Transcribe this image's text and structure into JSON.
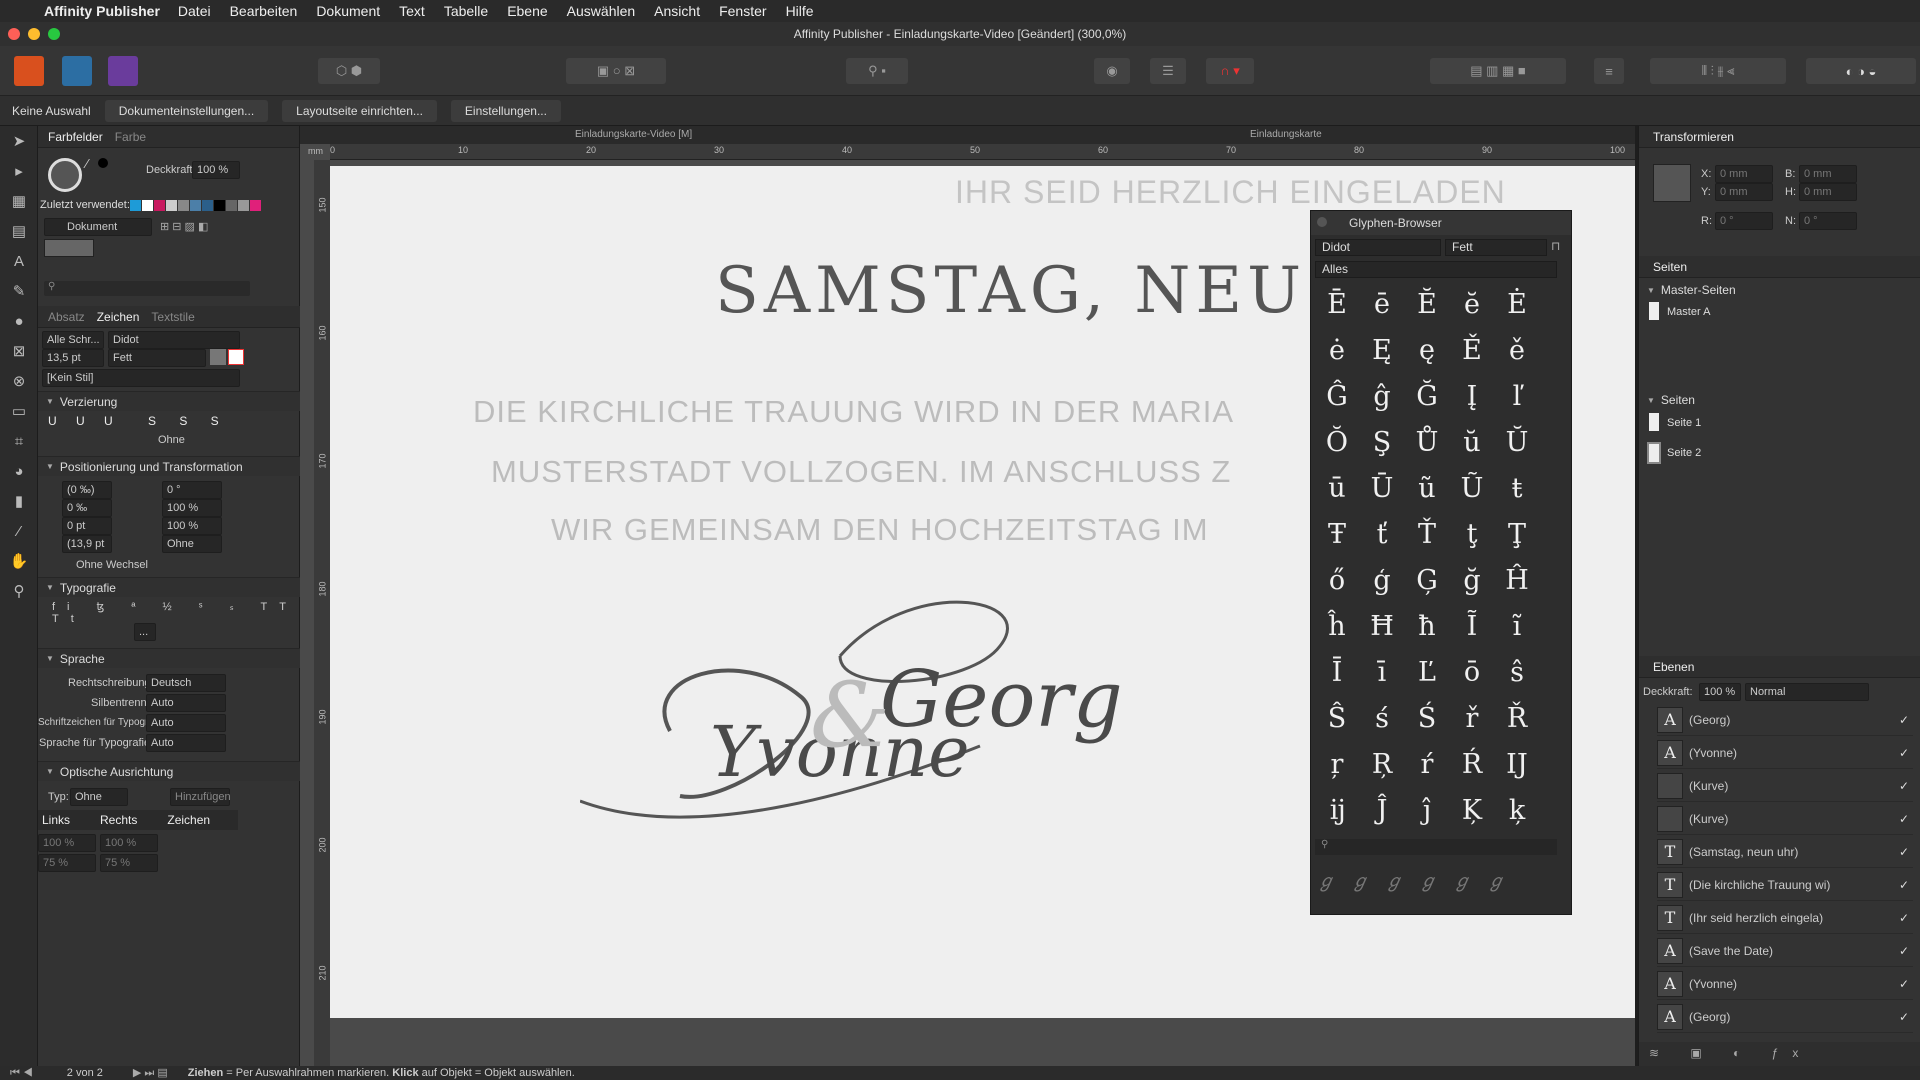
{
  "menubar": {
    "app": "Affinity Publisher",
    "items": [
      "Datei",
      "Bearbeiten",
      "Dokument",
      "Text",
      "Tabelle",
      "Ebene",
      "Auswählen",
      "Ansicht",
      "Fenster",
      "Hilfe"
    ]
  },
  "window_title": "Affinity Publisher - Einladungskarte-Video [Geändert] (300,0%)",
  "context": {
    "selection": "Keine Auswahl",
    "btn1": "Dokumenteinstellungen...",
    "btn2": "Layoutseite einrichten...",
    "btn3": "Einstellungen..."
  },
  "swatches": {
    "tab1": "Farbfelder",
    "tab2": "Farbe",
    "opacity_label": "Deckkraft:",
    "opacity": "100 %",
    "recent_label": "Zuletzt verwendet:",
    "palette": "Dokument",
    "recent_colors": [
      "#1e9bd7",
      "#ffffff",
      "#c8195f",
      "#cccccc",
      "#888888",
      "#4c7fa8",
      "#2b5f8a",
      "#000000",
      "#666666",
      "#999999",
      "#e0207a"
    ]
  },
  "character": {
    "tab1": "Absatz",
    "tab2": "Zeichen",
    "tab3": "Textstile",
    "font_collection": "Alle Schr...",
    "font": "Didot",
    "size": "13,5 pt",
    "weight": "Fett",
    "style": "[Kein Stil]",
    "sec_deco": "Verzierung",
    "deco_none": "Ohne",
    "sec_pos": "Positionierung und Transformation",
    "kerning": "(0 ‰)",
    "tracking": "0 ‰",
    "baseline": "0 pt",
    "leading": "(13,9 pt",
    "shear": "0 °",
    "vscale": "100 %",
    "hscale": "100 %",
    "pos": "Ohne",
    "nobreak": "Ohne Wechsel",
    "sec_typo": "Typografie",
    "more": "...",
    "sec_lang": "Sprache",
    "spell_l": "Rechtschreibung:",
    "spell": "Deutsch",
    "hyph_l": "Silbentrennung:",
    "hyph": "Auto",
    "glyph_l": "Schriftzeichen für Typografie:",
    "glyph": "Auto",
    "lang_l": "Sprache für Typografie:",
    "lang": "Auto",
    "sec_opt": "Optische Ausrichtung",
    "type_l": "Typ:",
    "type": "Ohne",
    "add": "Hinzufügen",
    "col1": "Links",
    "col2": "Rechts",
    "col3": "Zeichen",
    "r1a": "100 %",
    "r1b": "100 %",
    "r2a": "75 %",
    "r2b": "75 %"
  },
  "doc": {
    "tab1": "Einladungskarte-Video [M]",
    "tab2": "Einladungskarte",
    "ruler_unit": "mm",
    "hticks": [
      "0",
      "10",
      "20",
      "30",
      "40",
      "50",
      "60",
      "70",
      "80",
      "90",
      "100"
    ],
    "vticks": [
      "150",
      "160",
      "170",
      "180",
      "190",
      "200",
      "210"
    ]
  },
  "page_text": {
    "line1": "IHR SEID HERZLICH EINGELADEN",
    "line2": "SAMSTAG, NEU",
    "line3": "DIE KIRCHLICHE TRAUUNG WIRD IN DER MARIA",
    "line4": "MUSTERSTADT VOLLZOGEN. IM ANSCHLUSS Z",
    "line5": "WIR  GEMEINSAM DEN HOCHZEITSTAG IM",
    "script1": "Georg",
    "script2": "Yvonne",
    "amp": "&"
  },
  "glyph_browser": {
    "title": "Glyphen-Browser",
    "font": "Didot",
    "weight": "Fett",
    "range": "Alles",
    "glyphs": [
      "Ē",
      "ē",
      "Ĕ",
      "ĕ",
      "Ė",
      "ė",
      "Ę",
      "ę",
      "Ě",
      "ě",
      "Ĝ",
      "ĝ",
      "Ğ",
      "Į",
      "ľ",
      "Ŏ",
      "Ş",
      "Ů",
      "ŭ",
      "Ŭ",
      "ū",
      "Ū",
      "ũ",
      "Ũ",
      "ŧ",
      "Ŧ",
      "ť",
      "Ť",
      "ţ",
      "Ţ",
      "ő",
      "ģ",
      "Ģ",
      "ğ",
      "Ĥ",
      "ĥ",
      "Ħ",
      "ħ",
      "Ĩ",
      "ĩ",
      "Ī",
      "ī",
      "Ľ",
      "ō",
      "ŝ",
      "Ŝ",
      "ś",
      "Ś",
      "ř",
      "Ř",
      "ŗ",
      "Ŗ",
      "ŕ",
      "Ŕ",
      "Ĳ",
      "ĳ",
      "Ĵ",
      "ĵ",
      "Ķ",
      "ķ"
    ]
  },
  "transform": {
    "title": "Transformieren",
    "x_l": "X:",
    "x": "0 mm",
    "y_l": "Y:",
    "y": "0 mm",
    "b_l": "B:",
    "b": "0 mm",
    "h_l": "H:",
    "h": "0 mm",
    "r_l": "R:",
    "r": "0 °",
    "n_l": "N:",
    "n": "0 °"
  },
  "pages": {
    "title": "Seiten",
    "master_sec": "Master-Seiten",
    "master": "Master A",
    "pages_sec": "Seiten",
    "p1": "Seite 1",
    "p2": "Seite 2"
  },
  "layers": {
    "title": "Ebenen",
    "opacity_l": "Deckkraft:",
    "opacity": "100 %",
    "blend": "Normal",
    "items": [
      {
        "icon": "A",
        "name": "(Georg)"
      },
      {
        "icon": "A",
        "name": "(Yvonne)"
      },
      {
        "icon": "",
        "name": "(Kurve)"
      },
      {
        "icon": "",
        "name": "(Kurve)"
      },
      {
        "icon": "T",
        "name": "(Samstag, neun uhr)"
      },
      {
        "icon": "T",
        "name": "(Die kirchliche Trauung wi)"
      },
      {
        "icon": "T",
        "name": "(Ihr seid herzlich eingela)"
      },
      {
        "icon": "A",
        "name": "(Save the Date)"
      },
      {
        "icon": "A",
        "name": "(Yvonne)"
      },
      {
        "icon": "A",
        "name": "(Georg)"
      }
    ]
  },
  "status": {
    "page": "2 von 2",
    "hint_b1": "Ziehen",
    "hint1": " = Per Auswahlrahmen markieren. ",
    "hint_b2": "Klick",
    "hint2": " auf Objekt = Objekt auswählen."
  }
}
